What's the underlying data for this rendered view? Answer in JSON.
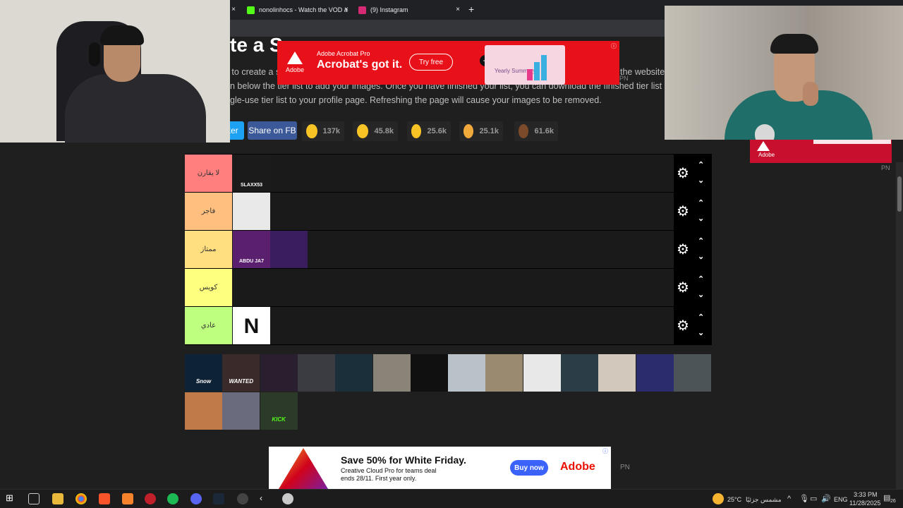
{
  "browser": {
    "tabs": [
      {
        "label": "nonolinhocs - Watch the VOD a",
        "favicon_color": "#53fc18"
      },
      {
        "label": "(9) Instagram",
        "favicon_color": "#d62976"
      }
    ],
    "new_tab": "+",
    "close": "×"
  },
  "page": {
    "title": "te a S",
    "intro_lines": [
      "e to create a s",
      "n below the tier list to add your images. Once you have finished your list, you can download the finished tier list image. It is",
      "gle-use tier list to your profile page. Refreshing the page will cause your images to be removed."
    ],
    "intro_right_fragment": "the website.",
    "share_twitter": "tter",
    "share_fb": "Share on FB",
    "reactions": [
      {
        "icon": "grin-emoji",
        "count": "137k",
        "color": "#f7c325"
      },
      {
        "icon": "heart-eyes-emoji",
        "count": "45.8k",
        "color": "#f7c325"
      },
      {
        "icon": "laugh-emoji",
        "count": "25.6k",
        "color": "#f7c325"
      },
      {
        "icon": "raised-hands-emoji",
        "count": "25.1k",
        "color": "#f2a93b"
      },
      {
        "icon": "poop-emoji",
        "count": "61.6k",
        "color": "#7b4a2a"
      }
    ]
  },
  "tiers": [
    {
      "label": "لا يقارن",
      "color": "#ff7f7f",
      "items": [
        {
          "caption": "SLAXX53",
          "bg": "#1b1b1b"
        }
      ]
    },
    {
      "label": "فاجر",
      "color": "#ffbf7f",
      "items": [
        {
          "caption": "",
          "bg": "#e9e9e9"
        }
      ]
    },
    {
      "label": "ممتاز",
      "color": "#ffdf7f",
      "items": [
        {
          "caption": "ABDU JA7",
          "bg": "#5a1f6e"
        },
        {
          "caption": "",
          "bg": "#3a1d5e"
        }
      ]
    },
    {
      "label": "كويس",
      "color": "#ffff7f",
      "items": []
    },
    {
      "label": "عادي",
      "color": "#bfff7f",
      "items": [
        {
          "caption": "N",
          "bg": "#ffffff"
        }
      ]
    }
  ],
  "pool": [
    {
      "caption": "Snow",
      "bg": "#0e2235"
    },
    {
      "caption": "WANTED",
      "bg": "#3a2a2a"
    },
    {
      "caption": "",
      "bg": "#2a1f2f"
    },
    {
      "caption": "",
      "bg": "#3a3c42"
    },
    {
      "caption": "",
      "bg": "#1a2f3a"
    },
    {
      "caption": "",
      "bg": "#8a8478"
    },
    {
      "caption": "",
      "bg": "#101010"
    },
    {
      "caption": "",
      "bg": "#b8c2c8"
    },
    {
      "caption": "",
      "bg": "#9a8a70"
    },
    {
      "caption": "",
      "bg": "#e8e8e8"
    },
    {
      "caption": "",
      "bg": "#2b3d46"
    },
    {
      "caption": "",
      "bg": "#d2c8bc"
    },
    {
      "caption": "",
      "bg": "#2a2c6e"
    },
    {
      "caption": "",
      "bg": "#4c5458"
    },
    {
      "caption": "",
      "bg": "#c07a4a"
    },
    {
      "caption": "",
      "bg": "#6a6c7e"
    },
    {
      "caption": "KICK",
      "bg": "#2c3a2a"
    }
  ],
  "ads": {
    "top": {
      "brand": "Adobe",
      "product": "Adobe Acrobat Pro",
      "headline": "Acrobat's got it.",
      "cta": "Try free",
      "doc": "Yearly Summary"
    },
    "bottom": {
      "headline": "Save 50% for White Friday.",
      "line1": "Creative Cloud Pro for teams deal",
      "line2": "ends 28/11. First year only.",
      "cta": "Buy now",
      "brand": "Adobe"
    },
    "right": {
      "brand": "Adobe"
    },
    "pn_label": "PN"
  },
  "taskbar": {
    "weather": "25°C",
    "weather_text": "مشمس جزئيًا",
    "lang": "ENG",
    "time": "3:33 PM",
    "date": "11/28/2025",
    "notif": "26"
  }
}
